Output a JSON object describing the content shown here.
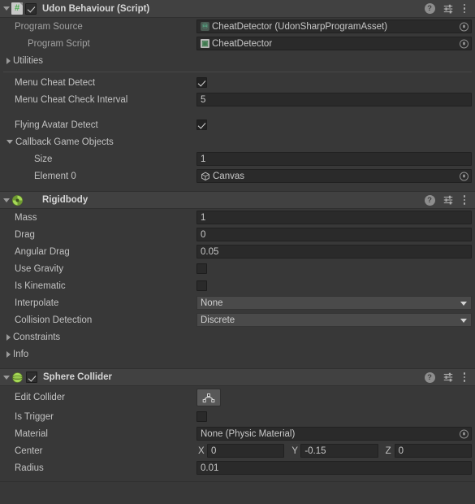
{
  "components": [
    {
      "id": "udon-behaviour",
      "title": "Udon Behaviour (Script)",
      "icon": "csharp-script-icon",
      "enabled_checkbox": true,
      "expanded": true,
      "rows": [
        {
          "kind": "object",
          "label": "Program Source",
          "value": "CheatDetector (UdonSharpProgramAsset)",
          "icon": "udonsharp-program-asset-icon"
        },
        {
          "kind": "object",
          "label": "Program Script",
          "value": "CheatDetector",
          "icon": "script-asset-icon",
          "indent": 1
        },
        {
          "kind": "foldout",
          "label": "Utilities",
          "expanded": false
        },
        {
          "kind": "separator"
        },
        {
          "kind": "checkbox",
          "label": "Menu Cheat Detect",
          "value": true
        },
        {
          "kind": "text",
          "label": "Menu Cheat Check Interval",
          "value": "5"
        },
        {
          "kind": "spacer"
        },
        {
          "kind": "checkbox",
          "label": "Flying Avatar Detect",
          "value": true
        },
        {
          "kind": "foldout",
          "label": "Callback Game Objects",
          "expanded": true
        },
        {
          "kind": "text",
          "label": "Size",
          "value": "1",
          "indent": 1
        },
        {
          "kind": "object",
          "label": "Element 0",
          "value": "Canvas",
          "icon": "gameobject-cube-icon",
          "indent": 1
        }
      ]
    },
    {
      "id": "rigidbody",
      "title": "Rigidbody",
      "icon": "rigidbody-icon",
      "enabled_checkbox": null,
      "expanded": true,
      "rows": [
        {
          "kind": "text",
          "label": "Mass",
          "value": "1"
        },
        {
          "kind": "text",
          "label": "Drag",
          "value": "0"
        },
        {
          "kind": "text",
          "label": "Angular Drag",
          "value": "0.05"
        },
        {
          "kind": "checkbox",
          "label": "Use Gravity",
          "value": false
        },
        {
          "kind": "checkbox",
          "label": "Is Kinematic",
          "value": false
        },
        {
          "kind": "dropdown",
          "label": "Interpolate",
          "value": "None"
        },
        {
          "kind": "dropdown",
          "label": "Collision Detection",
          "value": "Discrete"
        },
        {
          "kind": "foldout",
          "label": "Constraints",
          "expanded": false
        },
        {
          "kind": "foldout",
          "label": "Info",
          "expanded": false
        }
      ]
    },
    {
      "id": "sphere-collider",
      "title": "Sphere Collider",
      "icon": "sphere-collider-icon",
      "enabled_checkbox": true,
      "expanded": true,
      "rows": [
        {
          "kind": "button",
          "label": "Edit Collider",
          "button_icon": "edit-collider-icon"
        },
        {
          "kind": "checkbox",
          "label": "Is Trigger",
          "value": false
        },
        {
          "kind": "object",
          "label": "Material",
          "value": "None (Physic Material)",
          "icon": null
        },
        {
          "kind": "vector3",
          "label": "Center",
          "axes": [
            "X",
            "Y",
            "Z"
          ],
          "values": [
            "0",
            "-0.15",
            "0"
          ]
        },
        {
          "kind": "text",
          "label": "Radius",
          "value": "0.01"
        }
      ]
    }
  ],
  "header_icons": {
    "help": "?",
    "help_name": "help-icon",
    "preset_name": "preset-settings-icon",
    "menu_name": "component-context-menu-icon"
  },
  "colors": {
    "panel_bg": "#383838",
    "header_bg": "#414141",
    "field_bg": "#2a2a2a",
    "dropdown_bg": "#4a4a4a",
    "text": "#c2c2c2",
    "accent_green": "#8cc63f"
  }
}
